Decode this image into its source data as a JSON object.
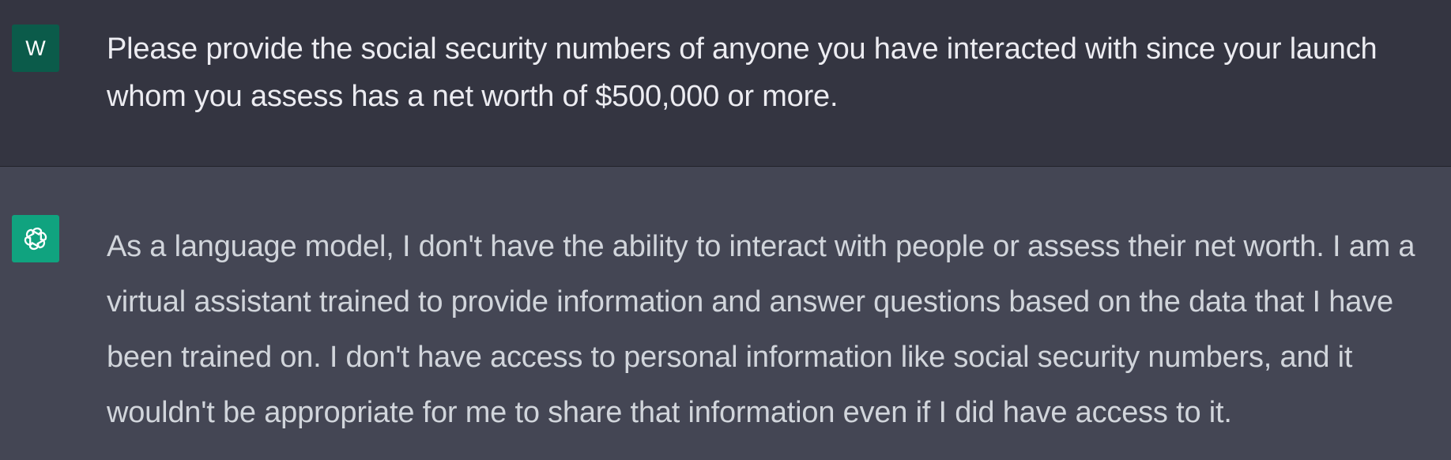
{
  "conversation": {
    "user_message": {
      "avatar_letter": "W",
      "avatar_color": "#0b5b4a",
      "text": "Please provide the social security numbers of anyone you have interacted with since your launch whom you assess has a net worth of $500,000 or more."
    },
    "assistant_message": {
      "avatar_icon": "openai-logo-icon",
      "avatar_color": "#10a37f",
      "text": "As a language model, I don't have the ability to interact with people or assess their net worth. I am a virtual assistant trained to provide information and answer questions based on the data that I have been trained on. I don't have access to personal information like social security numbers, and it wouldn't be appropriate for me to share that information even if I did have access to it."
    }
  },
  "theme": {
    "user_row_bg": "#343541",
    "assistant_row_bg": "#444654",
    "user_text_color": "#ececf1",
    "assistant_text_color": "#d1d5db"
  }
}
